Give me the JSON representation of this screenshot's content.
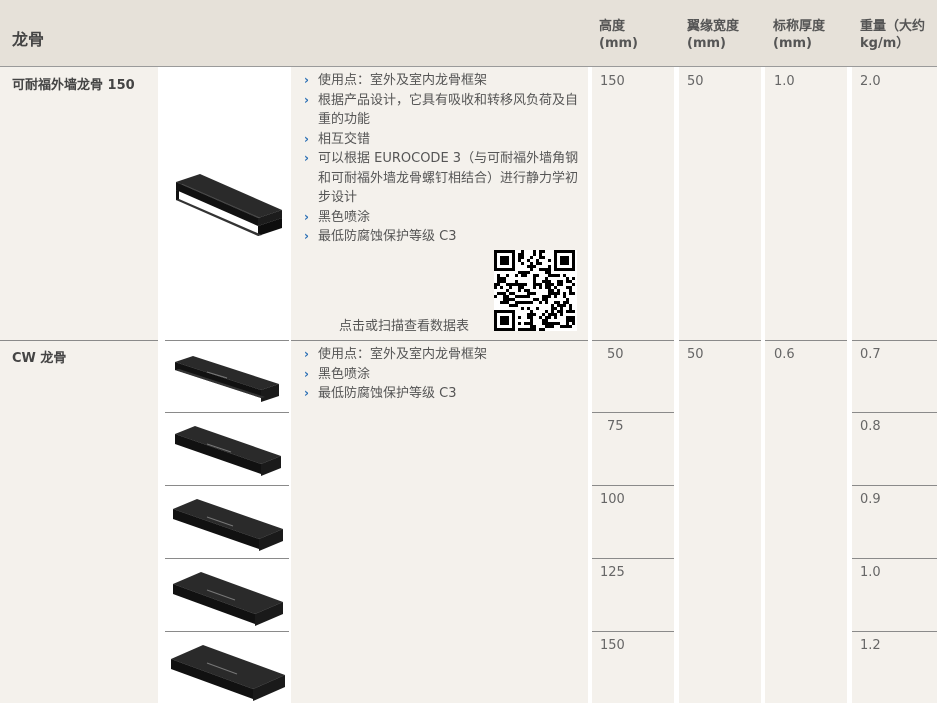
{
  "header": {
    "title": "龙骨",
    "col_height": "高度\n(mm)",
    "col_flange": "翼缘宽度\n(mm)",
    "col_thickness": "标称厚度\n(mm)",
    "col_weight": "重量（大约\nkg/m）"
  },
  "row1": {
    "name": "可耐福外墙龙骨 150",
    "features": [
      "使用点：室外及室内龙骨框架",
      "根据产品设计，它具有吸收和转移风负荷及自重的功能",
      "相互交错",
      "可以根据 EUROCODE 3（与可耐福外墙角钢和可耐福外墙龙骨螺钉相结合）进行静力学初步设计",
      "黑色喷涂",
      "最低防腐蚀保护等级 C3"
    ],
    "qr_caption": "点击或扫描查看数据表",
    "height": "150",
    "flange": "50",
    "thickness": "1.0",
    "weight": "2.0"
  },
  "row2": {
    "name": "CW 龙骨",
    "features": [
      "使用点：室外及室内龙骨框架",
      "黑色喷涂",
      "最低防腐蚀保护等级 C3"
    ],
    "flange": "50",
    "thickness": "0.6",
    "heights": [
      "50",
      "75",
      "100",
      "125",
      "150"
    ],
    "weights": [
      "0.7",
      "0.8",
      "0.9",
      "1.0",
      "1.2"
    ]
  },
  "icons": {
    "bullet": "›"
  }
}
